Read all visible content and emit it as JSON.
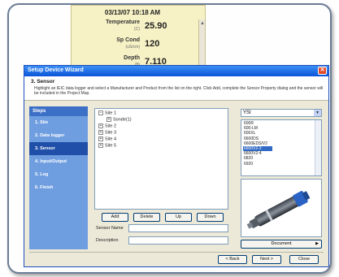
{
  "readings": {
    "timestamp": "03/13/07 10:18 AM",
    "rows": [
      {
        "label": "Temperature",
        "unit": "(C)",
        "value": "25.90"
      },
      {
        "label": "Sp Cond",
        "unit": "(uS/cm)",
        "value": "120"
      },
      {
        "label": "Depth",
        "unit": "(ft)",
        "value": "7.110"
      }
    ]
  },
  "wizard": {
    "title": "Setup Device Wizard",
    "close": "✕",
    "heading": "3. Sensor",
    "instructions": "Highlight an IEIC data logger and select a Manufacturer and Product from the list on the right. Click Add, complete the Sensor Property dialog and the sensor will be included in the Project Map.",
    "steps_header": "Steps",
    "steps": [
      "1. Site",
      "2. Data logger",
      "3. Sensor",
      "4. Input/Output",
      "5. Log",
      "6. Finish"
    ],
    "active_step": 2,
    "tree": [
      {
        "prefix": "⊟",
        "label": "Site 1"
      },
      {
        "prefix": "⊞",
        "label": "Sonde(1)",
        "indent": true
      },
      {
        "prefix": "⊞",
        "label": "Site 2"
      },
      {
        "prefix": "⊞",
        "label": "Site 3"
      },
      {
        "prefix": "⊞",
        "label": "Site 4"
      },
      {
        "prefix": "⊞",
        "label": "Site 5"
      }
    ],
    "buttons": {
      "add": "Add",
      "delete": "Delete",
      "up": "Up",
      "down": "Down"
    },
    "sensor_name_label": "Sensor Name",
    "description_label": "Description",
    "manufacturer": "YSI",
    "products": [
      "600R",
      "600-LM",
      "600XL",
      "6600DS",
      "6600EDS/V2",
      "6600V2-2",
      "6600V2-4",
      "6820",
      "6920"
    ],
    "selected_product": 5,
    "document_button": "Document",
    "nav": {
      "back": "< Back",
      "next": "Next >",
      "close": "Close"
    }
  }
}
